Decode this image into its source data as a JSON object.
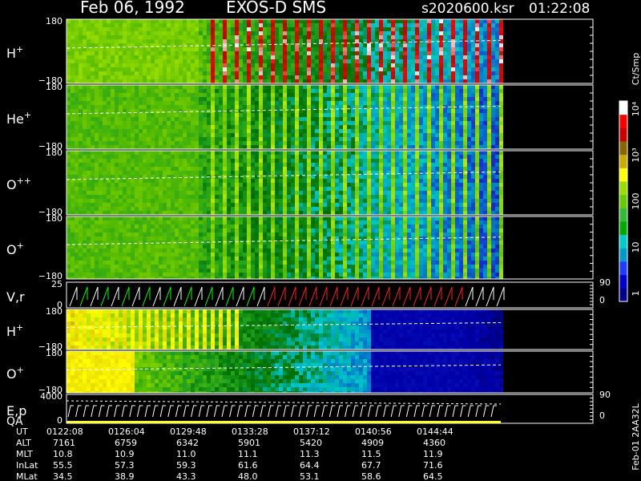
{
  "header": {
    "date": "Feb 06, 1992",
    "instrument": "EXOS-D SMS",
    "file": "s2020600.ksr",
    "time": "01:22:08"
  },
  "chart_data": {
    "type": "heatmap",
    "colorbar": {
      "label": "Ct/Smp",
      "ticks": [
        "1",
        "10",
        "100",
        "10³",
        "10⁴"
      ],
      "colors": [
        "#00008b",
        "#0000cd",
        "#1e3cff",
        "#0099cc",
        "#00cccc",
        "#00aa00",
        "#33bb33",
        "#66cc00",
        "#99dd00",
        "#ffff00",
        "#ccaa00",
        "#886600",
        "#cc0000",
        "#ff0000",
        "#ffffff"
      ]
    },
    "panels": [
      {
        "label": "H",
        "sup": "+",
        "ytop": "180",
        "ybot": "−180",
        "kind": "spec",
        "base": 0.55,
        "peak": 0.95
      },
      {
        "label": "He",
        "sup": "+",
        "ytop": "180",
        "ybot": "−180",
        "kind": "spec",
        "base": 0.5,
        "peak": 0.62
      },
      {
        "label": "O",
        "sup": "++",
        "ytop": "180",
        "ybot": "−180",
        "kind": "spec",
        "base": 0.5,
        "peak": 0.62
      },
      {
        "label": "O",
        "sup": "+",
        "ytop": "180",
        "ybot": "−180",
        "kind": "spec",
        "base": 0.5,
        "peak": 0.6
      },
      {
        "label": "V,r",
        "sup": "",
        "ytop": "25",
        "ybot": "0",
        "kind": "vr",
        "rightTop": "90",
        "rightBot": "0"
      },
      {
        "label": "H",
        "sup": "+",
        "ytop": "180",
        "ybot": "−180",
        "kind": "spec2",
        "base": 0.75
      },
      {
        "label": "O",
        "sup": "+",
        "ytop": "180",
        "ybot": "−180",
        "kind": "spec3",
        "base": 0.85
      },
      {
        "label": "E,p",
        "label2": "QA",
        "sup": "",
        "ytop": "4000",
        "ybot": "0",
        "kind": "ep",
        "rightTop": "90",
        "rightBot": "0"
      }
    ],
    "x": [
      "0122:08",
      "0126:04",
      "0129:48",
      "0133:28",
      "0137:12",
      "0140:56",
      "0144:44"
    ],
    "rows": [
      {
        "name": "UT",
        "values": [
          "0122:08",
          "0126:04",
          "0129:48",
          "0133:28",
          "0137:12",
          "0140:56",
          "0144:44"
        ]
      },
      {
        "name": "ALT",
        "values": [
          "7161",
          "6759",
          "6342",
          "5901",
          "5420",
          "4909",
          "4360"
        ]
      },
      {
        "name": "MLT",
        "values": [
          "10.8",
          "10.9",
          "11.0",
          "11.1",
          "11.3",
          "11.5",
          "11.9"
        ]
      },
      {
        "name": "InLat",
        "values": [
          "55.5",
          "57.3",
          "59.3",
          "61.6",
          "64.4",
          "67.7",
          "71.6"
        ]
      },
      {
        "name": "MLat",
        "values": [
          "34.5",
          "38.9",
          "43.3",
          "48.0",
          "53.1",
          "58.6",
          "64.5"
        ]
      }
    ],
    "side_label": "Feb-01 2AA32L"
  }
}
